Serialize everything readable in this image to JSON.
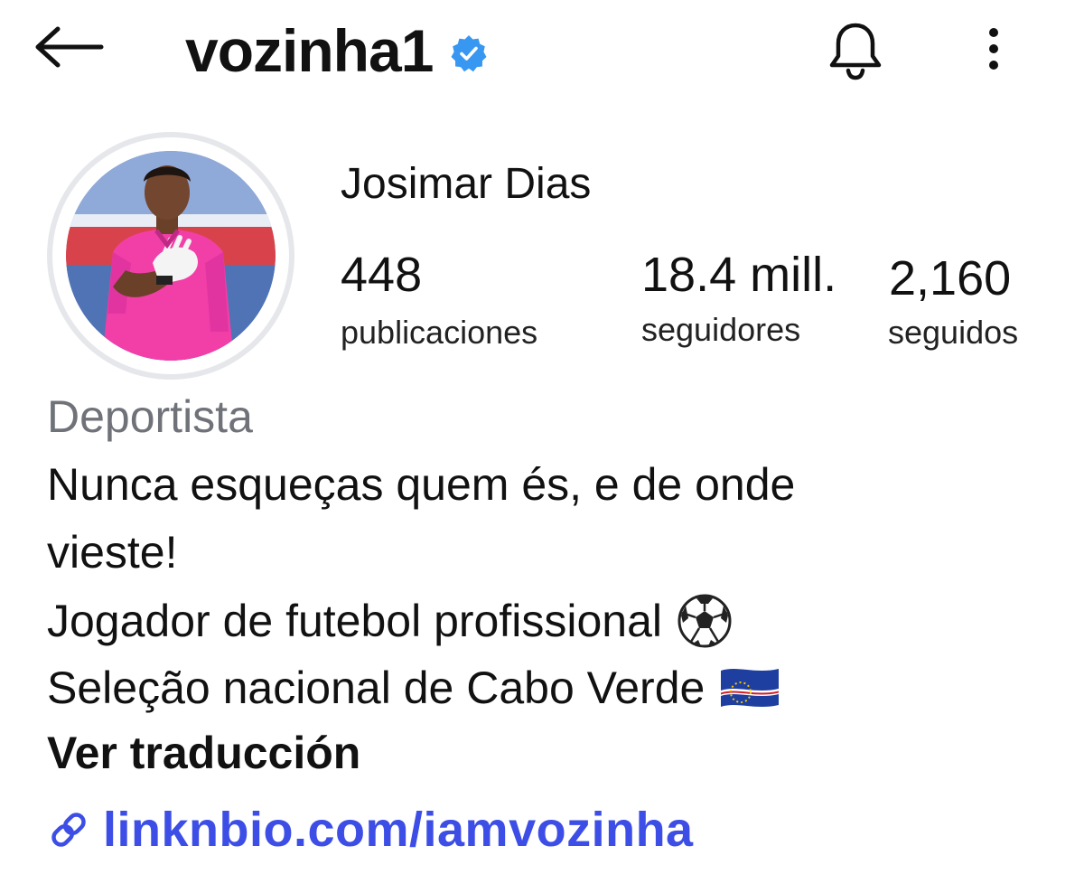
{
  "header": {
    "username": "vozinha1",
    "verified_color": "#3897f0"
  },
  "profile": {
    "full_name": "Josimar Dias",
    "stats": {
      "posts_value": "448",
      "posts_label": "publicaciones",
      "followers_value": "18.4 mill.",
      "followers_label": "seguidores",
      "following_value": "2,160",
      "following_label": "seguidos"
    },
    "category": "Deportista",
    "bio_lines": [
      "Nunca esqueças quem és, e de onde",
      "vieste!",
      "Jogador de futebol profissional",
      "Seleção nacional de Cabo Verde"
    ],
    "bio_emojis": [
      "soccer-ball-emoji",
      "cape-verde-flag-emoji"
    ],
    "translate_label": "Ver traducción",
    "link_text": "linknbio.com/iamvozinha",
    "link_color": "#3d4ee6"
  },
  "icons": [
    "back-arrow-icon",
    "verified-badge-icon",
    "bell-icon",
    "more-options-icon",
    "link-icon"
  ]
}
